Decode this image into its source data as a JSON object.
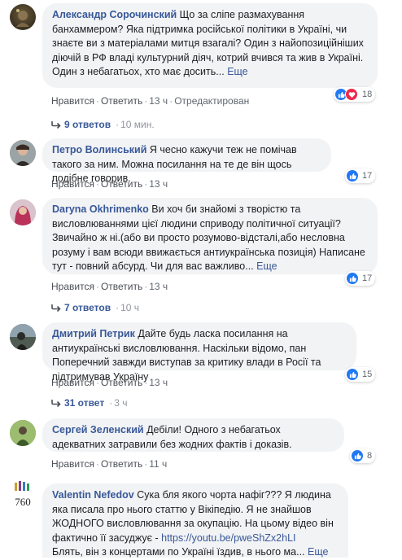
{
  "labels": {
    "like": "Нравится",
    "reply": "Ответить",
    "edited": "Отредактирован",
    "more": "Еще",
    "dot": "·"
  },
  "colors": {
    "link": "#385898",
    "like": "#2078f4",
    "love": "#f0284a",
    "bubble": "#f2f3f5"
  },
  "comments": [
    {
      "author": "Александр Сорочинский",
      "text": "Що за сліпе размахування банхаммером? Яка підтримка російської політики в Україні, чи знаєте ви з матеріалами митця взагалі? Один з найопозиційніших діючій в РФ владі культурний діяч, котрий вчився та жив в Україні. Один з небагатьох, хто має досить...",
      "time": "13 ч",
      "reactions": "18",
      "replies": {
        "count": "9 ответов",
        "time": "10 мин."
      }
    },
    {
      "author": "Петро Волинський",
      "text": "Я чесно кажучи теж не помічав такого за ним. Можна посилання на те де він щось подібне говорив.",
      "time": "13 ч",
      "reactions": "17"
    },
    {
      "author": "Daryna Okhrimenko",
      "text": "Ви хоч би знайомі з творістю та висловлюваннями цієї людини сприводу політичної ситуації? Звичайно ж ні.(або ви просто розумово-відсталі,або несловна розуму і вам всюди ввижається антиукраїнська позиція) Написане тут - повний абсурд. Чи для вас важливо...",
      "time": "13 ч",
      "reactions": "17",
      "replies": {
        "count": "7 ответов",
        "time": "10 ч"
      }
    },
    {
      "author": "Дмитрий Петрик",
      "text": "Дайте будь ласка посилання на антиукраїнські висловлювання. Наскільки відомо, пан Поперечний завжди виступав за критику влади в Росії та підтримував Україну",
      "time": "13 ч",
      "reactions": "15",
      "replies": {
        "count": "31 ответ",
        "time": "3 ч"
      }
    },
    {
      "author": "Сергей Зеленский",
      "text": "Дебіли! Одного з небагатьох адекватних затравили без жодних фактів і доказів.",
      "time": "11 ч",
      "reactions": "8"
    },
    {
      "author": "Valentin Nefedov",
      "text": "Сука бля якого чорта нафіг??? Я людина яка писала про нього статтю у Вікіпедію. Я не знайшов ЖОДНОГО висловлювання за окупацію. На цьому відео він фактично її засуджує -",
      "link": "https://youtu.be/pweShZx2hLI",
      "text2": "Блять, він з концертами по Україні їздив, в нього ма...",
      "avatar_text": "760"
    }
  ]
}
